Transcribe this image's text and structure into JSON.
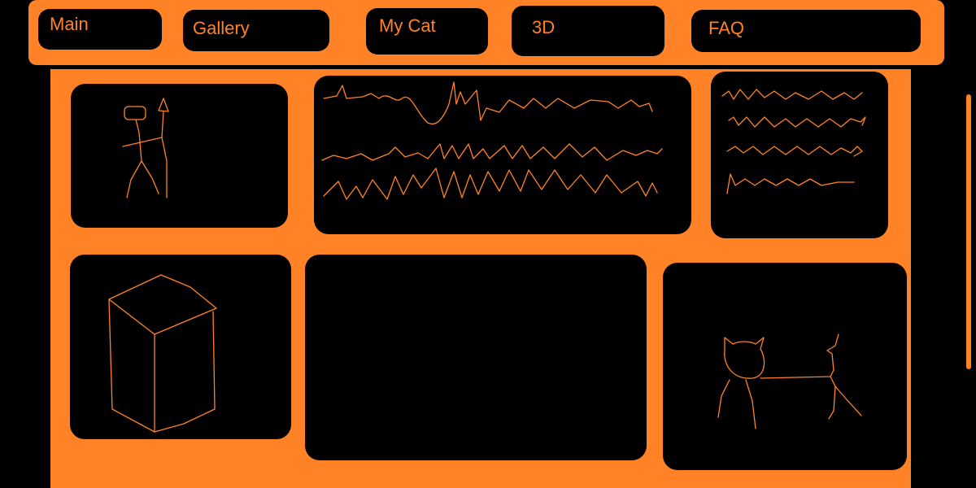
{
  "colors": {
    "accent": "#ff8326",
    "background": "#000000"
  },
  "nav": {
    "tabs": [
      {
        "label": "Main"
      },
      {
        "label": "Gallery"
      },
      {
        "label": "My Cat"
      },
      {
        "label": "3D"
      },
      {
        "label": "FAQ"
      }
    ]
  },
  "panels": [
    {
      "subject": "stick-figure-sketch"
    },
    {
      "subject": "handwritten-scribble-text"
    },
    {
      "subject": "handwritten-scribble-text-small"
    },
    {
      "subject": "cube-sketch"
    },
    {
      "subject": "empty"
    },
    {
      "subject": "cat-sketch"
    }
  ]
}
